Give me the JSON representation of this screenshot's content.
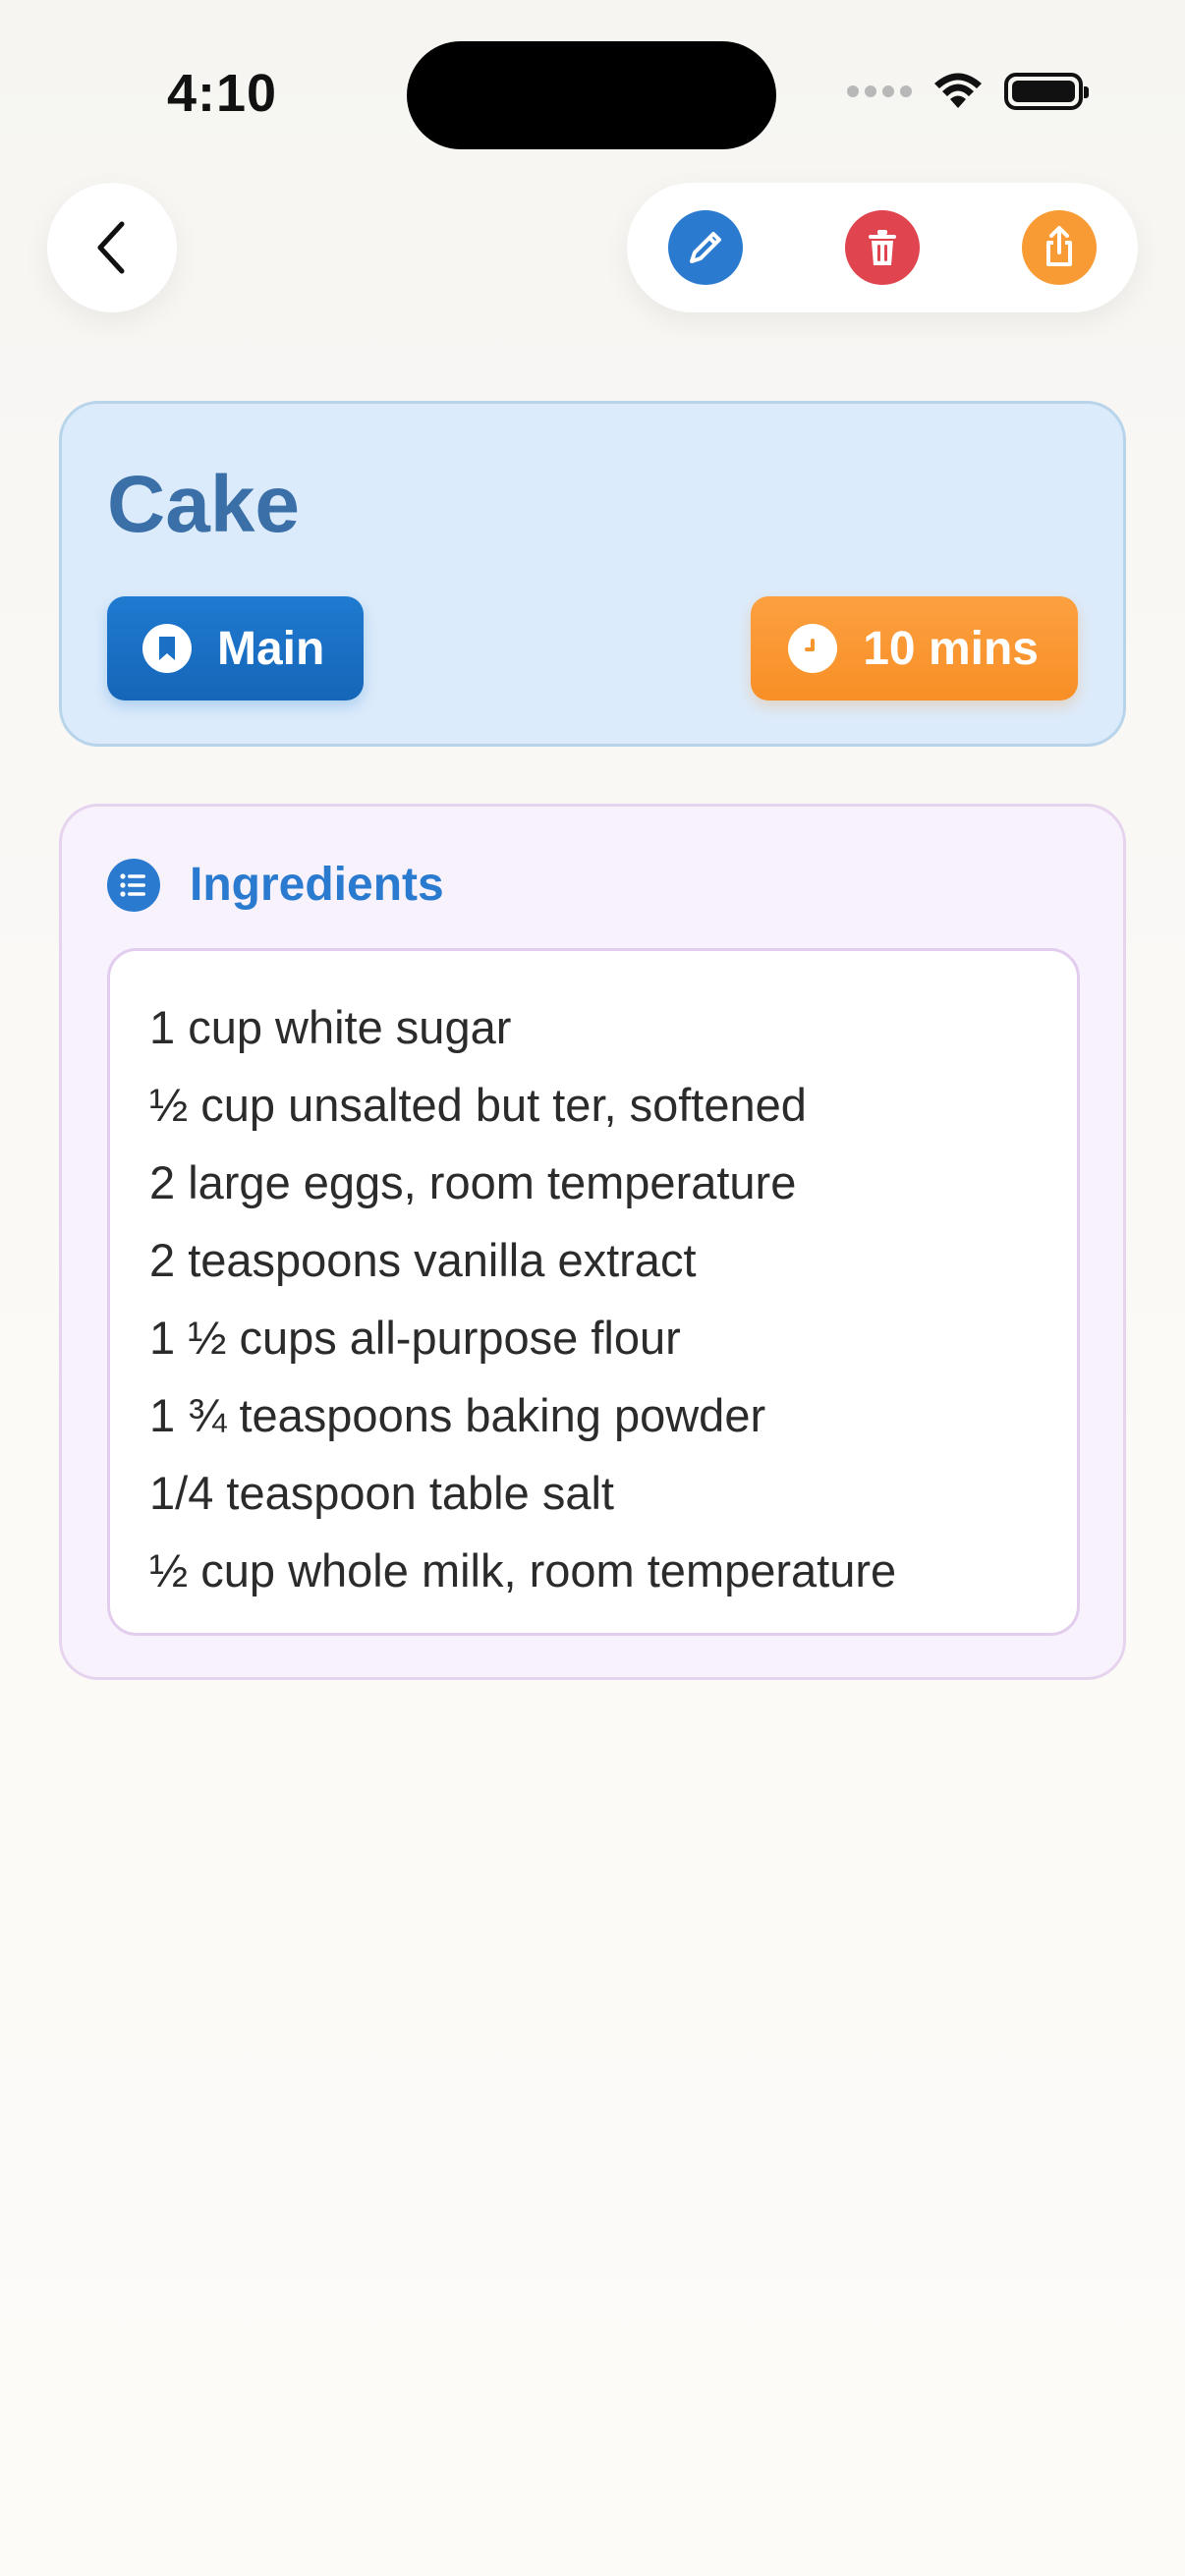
{
  "status_bar": {
    "time": "4:10"
  },
  "nav": {
    "back_icon": "chevron-left-icon",
    "actions": [
      {
        "name": "edit",
        "icon": "pencil-icon",
        "color": "#2a7bd0"
      },
      {
        "name": "delete",
        "icon": "trash-icon",
        "color": "#e0454f"
      },
      {
        "name": "share",
        "icon": "share-icon",
        "color": "#f89b34"
      }
    ]
  },
  "recipe": {
    "title": "Cake",
    "category": "Main",
    "time": "10 mins"
  },
  "ingredients": {
    "title": "Ingredients",
    "items": [
      "1 cup white sugar",
      "½ cup unsalted but ter, softened",
      "2 large eggs, room temperature",
      "2 teaspoons vanilla extract",
      "1 ½ cups all-purpose flour",
      "1 ¾ teaspoons baking powder",
      "1/4 teaspoon table salt",
      "½ cup whole milk, room temperature"
    ]
  },
  "colors": {
    "accent_blue": "#2a7bd0",
    "accent_orange": "#f89b34",
    "danger": "#e0454f",
    "header_bg": "#dcebfb",
    "ingredients_bg": "#f8f2fc"
  }
}
